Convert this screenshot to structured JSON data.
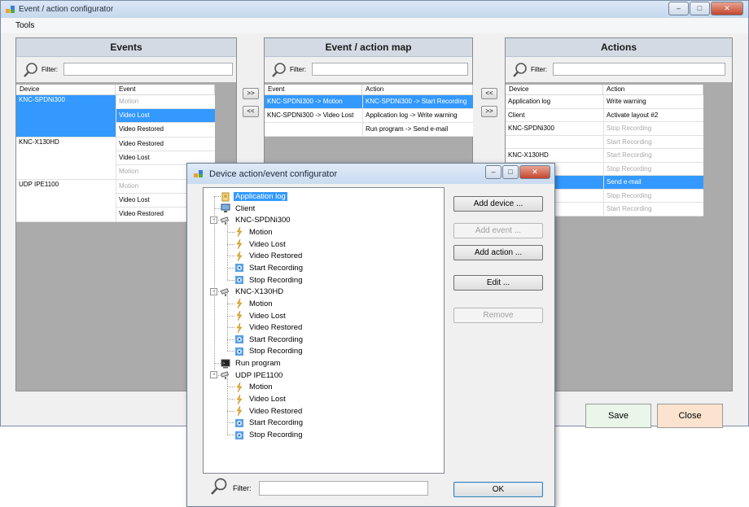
{
  "main": {
    "title": "Event / action configurator",
    "menu": [
      "Tools"
    ],
    "filter_label": "Filter:",
    "events": {
      "header": "Events",
      "columns": [
        "Device",
        "Event"
      ],
      "devices": [
        {
          "name": "KNC-SPDNi300",
          "events": [
            {
              "label": "Motion",
              "state": "grey"
            },
            {
              "label": "Video Lost",
              "state": "selected"
            },
            {
              "label": "Video Restored",
              "state": "normal"
            }
          ]
        },
        {
          "name": "KNC-X130HD",
          "events": [
            {
              "label": "Video Restored",
              "state": "normal"
            },
            {
              "label": "Video Lost",
              "state": "normal"
            },
            {
              "label": "Motion",
              "state": "grey"
            }
          ]
        },
        {
          "name": "UDP IPE1100",
          "events": [
            {
              "label": "Motion",
              "state": "grey"
            },
            {
              "label": "Video Lost",
              "state": "normal"
            },
            {
              "label": "Video Restored",
              "state": "normal"
            }
          ]
        }
      ]
    },
    "map": {
      "header": "Event / action map",
      "columns": [
        "Event",
        "Action"
      ],
      "rows": [
        {
          "event": "KNC-SPDNi300 -> Motion",
          "action": "KNC-SPDNi300 -> Start Recording"
        },
        {
          "event": "KNC-SPDNi300 -> Video Lost",
          "action": "Application log -> Write warning"
        },
        {
          "event": "",
          "action": "Run program -> Send e-mail"
        }
      ]
    },
    "actions": {
      "header": "Actions",
      "columns": [
        "Device",
        "Action"
      ],
      "rows": [
        {
          "device": "Application log",
          "action": "Write warning",
          "state": "normal"
        },
        {
          "device": "Client",
          "action": "Activate layout #2",
          "state": "normal"
        },
        {
          "device": "KNC-SPDNi300",
          "action": "Stop Recording",
          "state": "grey"
        },
        {
          "device": "",
          "action": "Start Recording",
          "state": "grey"
        },
        {
          "device": "KNC-X130HD",
          "action": "Start Recording",
          "state": "grey"
        },
        {
          "device": "",
          "action": "Stop Recording",
          "state": "grey"
        },
        {
          "device": "",
          "action": "Send e-mail",
          "state": "selected"
        },
        {
          "device": "",
          "action": "Stop Recording",
          "state": "grey"
        },
        {
          "device": "",
          "action": "Start Recording",
          "state": "grey"
        }
      ]
    },
    "buttons": {
      "add": ">>",
      "remove": "<<",
      "save": "Save",
      "close": "Close"
    },
    "colors": {
      "save_bg": "#eaf6ea",
      "close_bg": "#fbe3cf",
      "selection": "#3399ff"
    }
  },
  "dialog": {
    "title": "Device action/event configurator",
    "tree": [
      {
        "label": "Application log",
        "icon": "log-icon",
        "level": 0,
        "selected": true
      },
      {
        "label": "Client",
        "icon": "monitor-icon",
        "level": 0
      },
      {
        "label": "KNC-SPDNi300",
        "icon": "camera-icon",
        "level": 0,
        "expander": "-"
      },
      {
        "label": "Motion",
        "icon": "event-bolt-icon",
        "level": 1
      },
      {
        "label": "Video Lost",
        "icon": "event-bolt-icon",
        "level": 1
      },
      {
        "label": "Video Restored",
        "icon": "event-bolt-icon",
        "level": 1
      },
      {
        "label": "Start Recording",
        "icon": "action-gear-icon",
        "level": 1
      },
      {
        "label": "Stop Recording",
        "icon": "action-gear-icon",
        "level": 1
      },
      {
        "label": "KNC-X130HD",
        "icon": "camera-icon",
        "level": 0,
        "expander": "-"
      },
      {
        "label": "Motion",
        "icon": "event-bolt-icon",
        "level": 1
      },
      {
        "label": "Video Lost",
        "icon": "event-bolt-icon",
        "level": 1
      },
      {
        "label": "Video Restored",
        "icon": "event-bolt-icon",
        "level": 1
      },
      {
        "label": "Start Recording",
        "icon": "action-gear-icon",
        "level": 1
      },
      {
        "label": "Stop Recording",
        "icon": "action-gear-icon",
        "level": 1
      },
      {
        "label": "Run program",
        "icon": "terminal-icon",
        "level": 0
      },
      {
        "label": "UDP IPE1100",
        "icon": "camera-icon",
        "level": 0,
        "expander": "-"
      },
      {
        "label": "Motion",
        "icon": "event-bolt-icon",
        "level": 1
      },
      {
        "label": "Video Lost",
        "icon": "event-bolt-icon",
        "level": 1
      },
      {
        "label": "Video Restored",
        "icon": "event-bolt-icon",
        "level": 1
      },
      {
        "label": "Start Recording",
        "icon": "action-gear-icon",
        "level": 1
      },
      {
        "label": "Stop Recording",
        "icon": "action-gear-icon",
        "level": 1
      }
    ],
    "buttons": [
      {
        "label": "Add device ...",
        "enabled": true
      },
      {
        "label": "Add event ...",
        "enabled": false
      },
      {
        "label": "Add action ...",
        "enabled": true
      },
      {
        "label": "Edit ...",
        "enabled": true
      },
      {
        "label": "Remove",
        "enabled": false
      }
    ],
    "filter_label": "Filter:",
    "ok_label": "OK"
  }
}
